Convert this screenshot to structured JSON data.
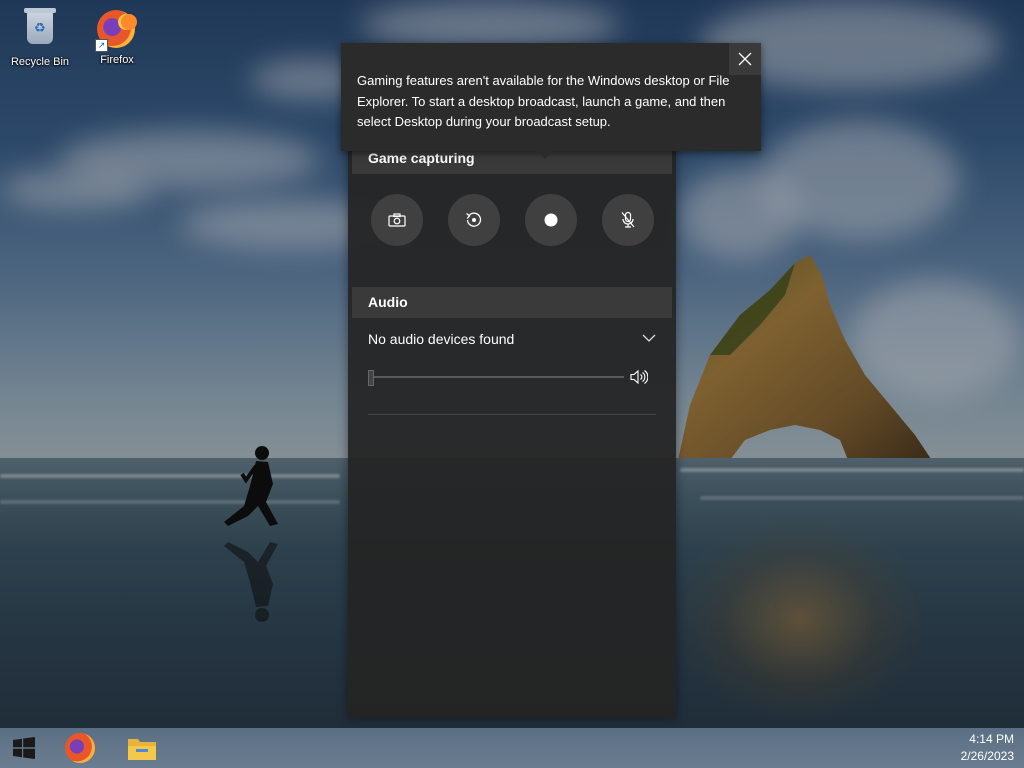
{
  "desktop": {
    "icons": [
      {
        "label": "Recycle Bin",
        "icon": "recycle-bin-icon"
      },
      {
        "label": "Firefox",
        "icon": "firefox-icon"
      }
    ]
  },
  "tooltip": {
    "message": "Gaming features aren't available for the Windows desktop or File Explorer. To start a desktop broadcast, launch a game, and then select Desktop during your broadcast setup.",
    "close_icon": "close-icon"
  },
  "game_capturing": {
    "title": "Game capturing",
    "buttons": [
      {
        "icon": "camera-icon"
      },
      {
        "icon": "replay-icon"
      },
      {
        "icon": "record-icon"
      },
      {
        "icon": "mic-off-icon"
      }
    ]
  },
  "audio": {
    "title": "Audio",
    "device": "No audio devices found",
    "volume": 0,
    "volume_icon": "speaker-icon"
  },
  "taskbar": {
    "items": [
      "start-icon",
      "firefox-icon",
      "file-explorer-icon"
    ],
    "time": "4:14 PM",
    "date": "2/26/2023"
  },
  "colors": {
    "panel_bg": "#242424",
    "header_bg": "#3a3a3a",
    "button_bg": "#404040",
    "tooltip_bg": "#2b2b2b"
  }
}
